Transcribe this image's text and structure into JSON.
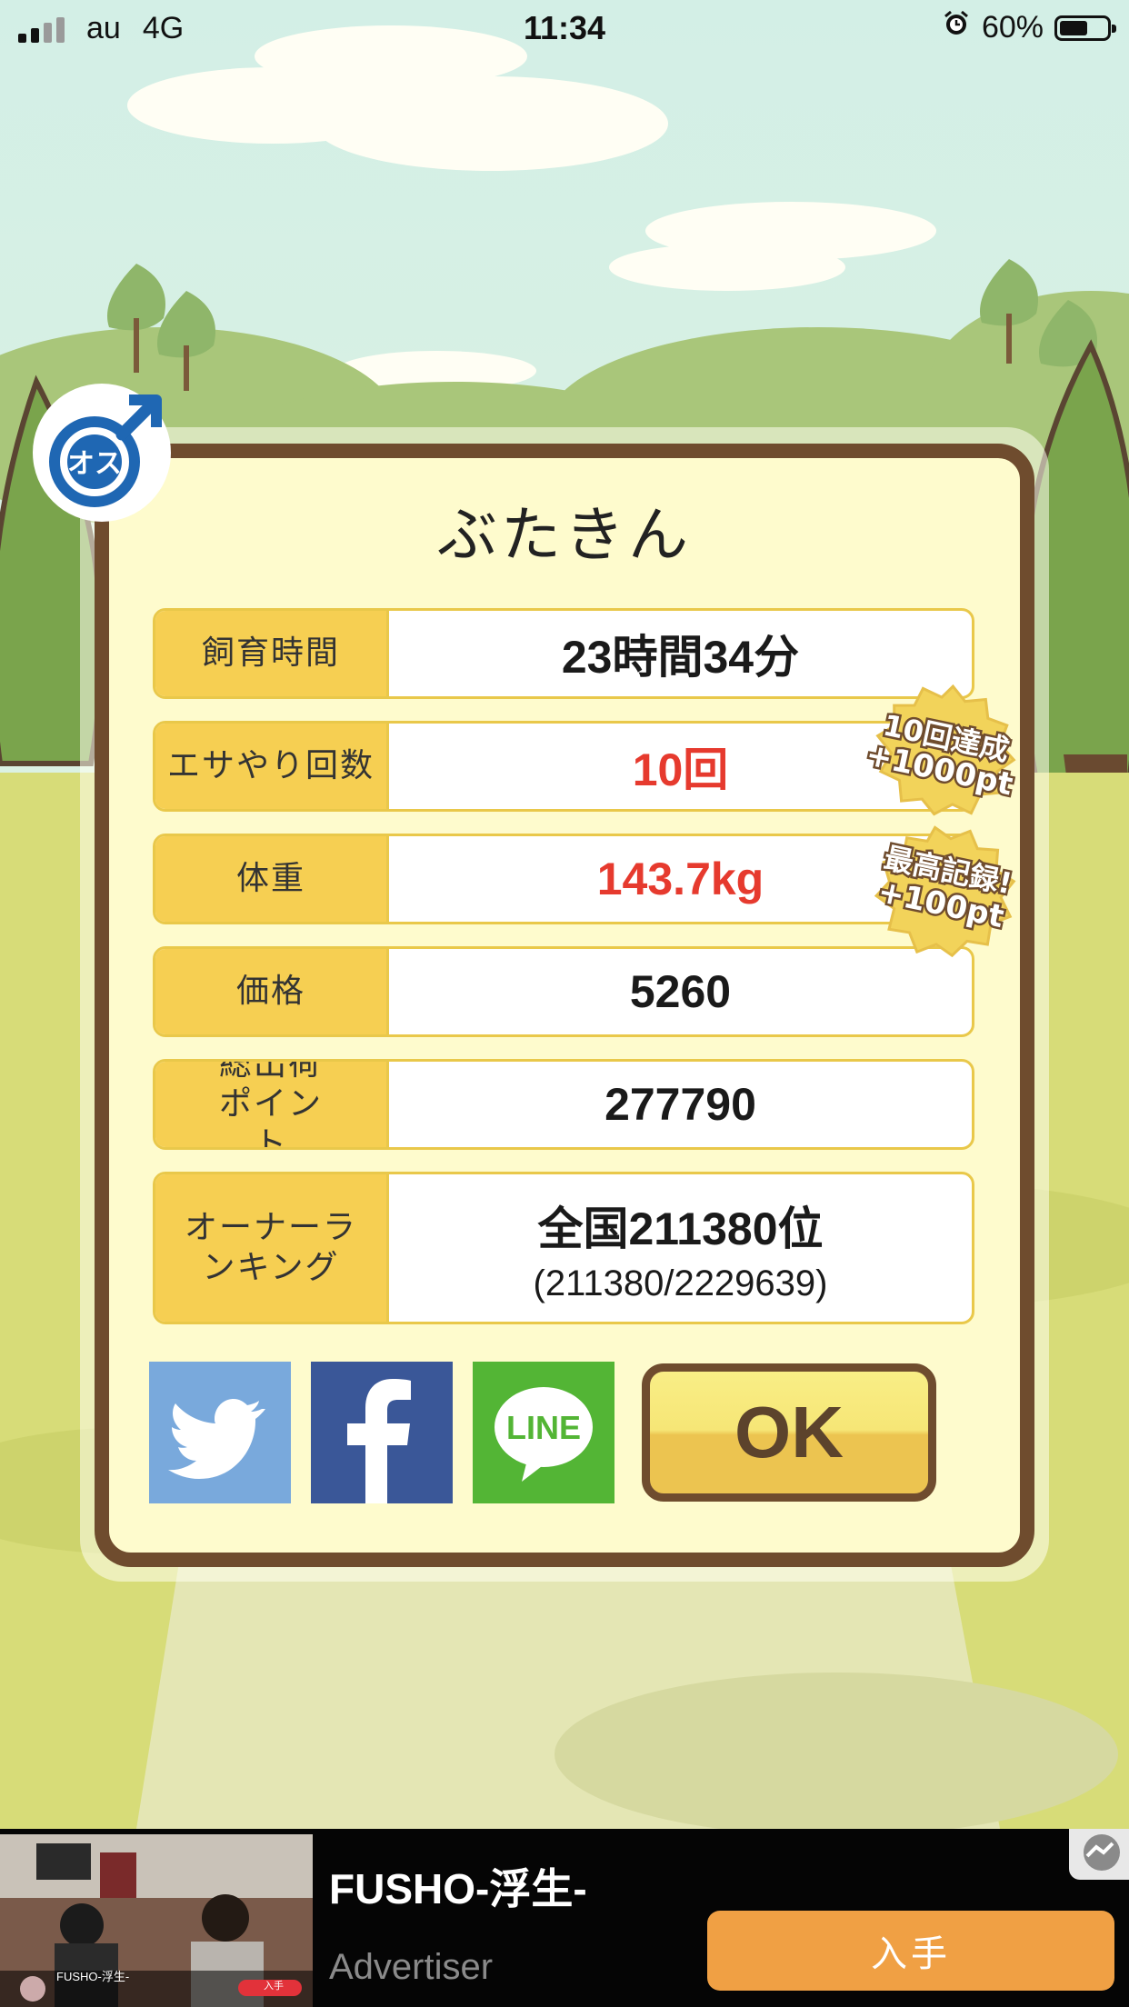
{
  "status_bar": {
    "carrier": "au",
    "network": "4G",
    "time": "11:34",
    "battery_percent": "60%",
    "battery_level": 0.6
  },
  "dialog": {
    "gender_badge": "オス",
    "pet_name": "ぶたきん",
    "rows": [
      {
        "label": "飼育時間",
        "value": "23時間34分"
      },
      {
        "label": "エサやり回数",
        "value": "10回"
      },
      {
        "label": "体重",
        "value": "143.7kg"
      },
      {
        "label": "価格",
        "value": "5260"
      },
      {
        "label": "総出荷ポイント",
        "value": "277790"
      },
      {
        "label": "オーナーランキング",
        "value": "全国211380位",
        "sub": "(211380/2229639)"
      }
    ],
    "achievements": [
      {
        "line1": "10回達成",
        "line2": "+1000pt"
      },
      {
        "line1": "最高記録!",
        "line2": "+100pt"
      }
    ],
    "social": {
      "twitter": "twitter",
      "facebook": "facebook",
      "line": "LINE"
    },
    "ok_label": "OK"
  },
  "ad": {
    "title": "FUSHO-浮生-",
    "advertiser": "Advertiser",
    "cta": "入手",
    "thumb_caption": "FUSHO-浮生-",
    "thumb_cta": "入手"
  },
  "colors": {
    "frame": "#6f4c2e",
    "label_bg": "#f6cf52",
    "value_red": "#e63a2e",
    "twitter": "#79a9dc",
    "facebook": "#3a5798",
    "line": "#53b535",
    "ad_cta": "#f0a044"
  }
}
